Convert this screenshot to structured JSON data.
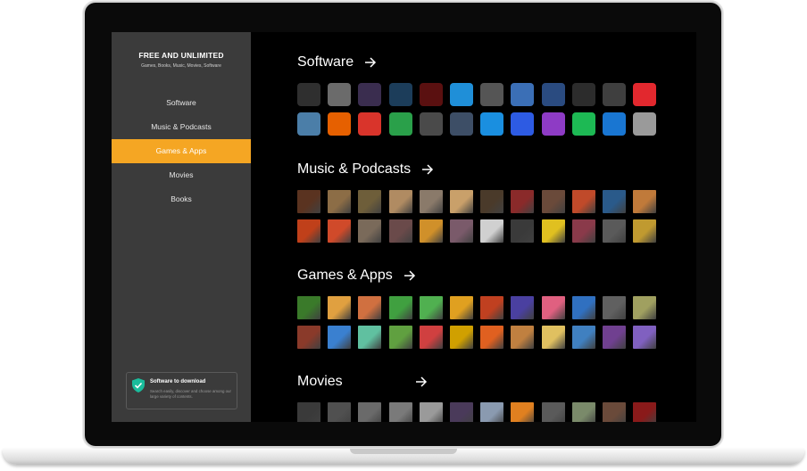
{
  "sidebar": {
    "title": "FREE AND UNLIMITED",
    "subtitle": "Games, Books, Music, Movies, Software",
    "items": [
      {
        "label": "Software"
      },
      {
        "label": "Music & Podcasts"
      },
      {
        "label": "Games & Apps"
      },
      {
        "label": "Movies"
      },
      {
        "label": "Books"
      }
    ],
    "active_index": 2,
    "promo": {
      "title": "Software to download",
      "text": "Search easily, discover and choose among our large variety of contents."
    }
  },
  "colors": {
    "accent": "#f5a623",
    "sidebar": "#3b3b3b",
    "screen": "#000000",
    "promo_shield": "#1abc9c"
  },
  "sections": [
    {
      "title": "Software",
      "tiles": [
        {
          "icon": "zip-icon",
          "color": "#2f2f2f"
        },
        {
          "icon": "colorful-app-icon",
          "color": "#6b6b6b"
        },
        {
          "icon": "feather-icon",
          "color": "#3a2d4f"
        },
        {
          "icon": "circle-logo-icon",
          "color": "#1c3d5a"
        },
        {
          "icon": "pdf-icon",
          "color": "#5a1010"
        },
        {
          "icon": "swirl-icon",
          "color": "#1f8fd8"
        },
        {
          "icon": "f-letter-icon",
          "color": "#555555"
        },
        {
          "icon": "bird-icon",
          "color": "#3b6fb6"
        },
        {
          "icon": "squares-icon",
          "color": "#2a4b80"
        },
        {
          "icon": "disc-icon",
          "color": "#2c2c2c"
        },
        {
          "icon": "monitor-icon",
          "color": "#3f3f3f"
        },
        {
          "icon": "c-letter-icon",
          "color": "#e2282e"
        },
        {
          "icon": "folder-icon",
          "color": "#4b7ea8"
        },
        {
          "icon": "firefox-icon",
          "color": "#e66000"
        },
        {
          "icon": "a-letter-icon",
          "color": "#d9342b"
        },
        {
          "icon": "quote-icon",
          "color": "#2aa04a"
        },
        {
          "icon": "sumo-icon",
          "color": "#4a4a4a"
        },
        {
          "icon": "dots-icon",
          "color": "#3d4e66"
        },
        {
          "icon": "arrows-icon",
          "color": "#1a8fe0"
        },
        {
          "icon": "r-letter-icon",
          "color": "#2d5be3"
        },
        {
          "icon": "s-letter-icon",
          "color": "#8e3bc5"
        },
        {
          "icon": "spotify-icon",
          "color": "#1db954"
        },
        {
          "icon": "s-circle-icon",
          "color": "#1976d2"
        },
        {
          "icon": "gear-icon",
          "color": "#9a9a9a"
        }
      ]
    },
    {
      "title": "Music & Podcasts",
      "tiles": [
        {
          "icon": "album-art",
          "color": "#5a3320"
        },
        {
          "icon": "album-art",
          "color": "#8c6d46"
        },
        {
          "icon": "album-art",
          "color": "#6e5e3a"
        },
        {
          "icon": "album-art",
          "color": "#b08b62"
        },
        {
          "icon": "album-art",
          "color": "#8a7a6a"
        },
        {
          "icon": "album-art",
          "color": "#c9a06a"
        },
        {
          "icon": "album-art",
          "color": "#4a3a2a"
        },
        {
          "icon": "album-art",
          "color": "#8a2a2a"
        },
        {
          "icon": "album-art",
          "color": "#6a4a3a"
        },
        {
          "icon": "album-art",
          "color": "#c04a2a"
        },
        {
          "icon": "album-art",
          "color": "#2a5a8a"
        },
        {
          "icon": "album-art",
          "color": "#c07a3a"
        },
        {
          "icon": "album-art",
          "color": "#c0401a"
        },
        {
          "icon": "album-art",
          "color": "#d04a2a"
        },
        {
          "icon": "album-art",
          "color": "#7a6a5a"
        },
        {
          "icon": "album-art",
          "color": "#6a4a4a"
        },
        {
          "icon": "album-art",
          "color": "#d0902a"
        },
        {
          "icon": "album-art",
          "color": "#7a5a6a"
        },
        {
          "icon": "album-art",
          "color": "#d0d0d0"
        },
        {
          "icon": "album-art",
          "color": "#3a3a3a"
        },
        {
          "icon": "album-art",
          "color": "#e0c020"
        },
        {
          "icon": "album-art",
          "color": "#8a3a4a"
        },
        {
          "icon": "album-art",
          "color": "#5a5a5a"
        },
        {
          "icon": "album-art",
          "color": "#c09a30"
        }
      ]
    },
    {
      "title": "Games & Apps",
      "tiles": [
        {
          "icon": "game-art",
          "color": "#3a7a2a"
        },
        {
          "icon": "game-art",
          "color": "#e0a040"
        },
        {
          "icon": "game-art",
          "color": "#d07040"
        },
        {
          "icon": "game-art",
          "color": "#40a040"
        },
        {
          "icon": "game-art",
          "color": "#50b050"
        },
        {
          "icon": "game-art",
          "color": "#e0a020"
        },
        {
          "icon": "game-art",
          "color": "#c04020"
        },
        {
          "icon": "game-art",
          "color": "#4a40a0"
        },
        {
          "icon": "game-art",
          "color": "#e06080"
        },
        {
          "icon": "game-art",
          "color": "#3070c0"
        },
        {
          "icon": "game-art",
          "color": "#606060"
        },
        {
          "icon": "game-art",
          "color": "#a0a060"
        },
        {
          "icon": "game-art",
          "color": "#8a3a2a"
        },
        {
          "icon": "game-art",
          "color": "#3a80d0"
        },
        {
          "icon": "game-art",
          "color": "#60c0a0"
        },
        {
          "icon": "game-art",
          "color": "#60a040"
        },
        {
          "icon": "game-art",
          "color": "#d04040"
        },
        {
          "icon": "game-art",
          "color": "#d0a000"
        },
        {
          "icon": "game-art",
          "color": "#e06020"
        },
        {
          "icon": "game-art",
          "color": "#c08040"
        },
        {
          "icon": "game-art",
          "color": "#e0c060"
        },
        {
          "icon": "game-art",
          "color": "#4080c0"
        },
        {
          "icon": "game-art",
          "color": "#704090"
        },
        {
          "icon": "game-art",
          "color": "#8060c0"
        }
      ]
    },
    {
      "title": "Movies",
      "tiles": [
        {
          "icon": "movie-art",
          "color": "#3a3a3a"
        },
        {
          "icon": "movie-art",
          "color": "#505050"
        },
        {
          "icon": "movie-art",
          "color": "#6a6a6a"
        },
        {
          "icon": "movie-art",
          "color": "#7a7a7a"
        },
        {
          "icon": "movie-art",
          "color": "#9a9a9a"
        },
        {
          "icon": "movie-art",
          "color": "#4a3a5a"
        },
        {
          "icon": "movie-art",
          "color": "#8a9ab0"
        },
        {
          "icon": "movie-art",
          "color": "#e08020"
        },
        {
          "icon": "movie-art",
          "color": "#5a5a5a"
        },
        {
          "icon": "movie-art",
          "color": "#7a8a6a"
        },
        {
          "icon": "movie-art",
          "color": "#6a4a3a"
        },
        {
          "icon": "movie-art",
          "color": "#8a1a1a"
        }
      ]
    }
  ]
}
